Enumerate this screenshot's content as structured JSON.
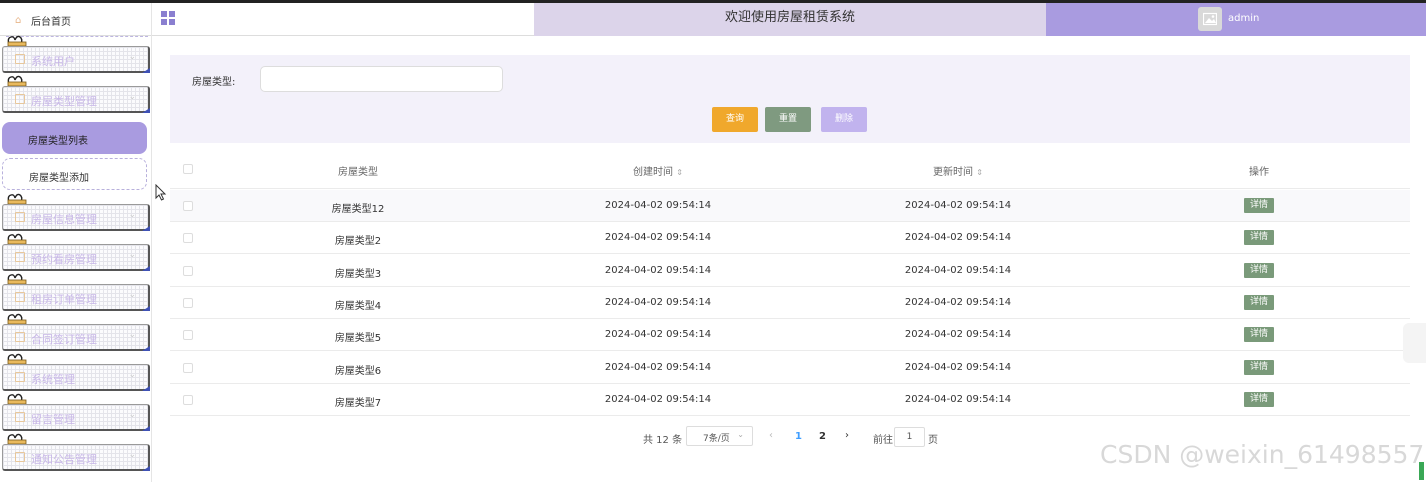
{
  "header": {
    "title": "欢迎使用房屋租赁系统",
    "username": "admin"
  },
  "sidebar": {
    "home_label": "后台首页",
    "items": [
      {
        "label": "系统用户"
      },
      {
        "label": "房屋类型管理"
      },
      {
        "label": "房屋信息管理"
      },
      {
        "label": "预约看房管理"
      },
      {
        "label": "租房订单管理"
      },
      {
        "label": "合同签订管理"
      },
      {
        "label": "系统管理"
      },
      {
        "label": "留言管理"
      },
      {
        "label": "通知公告管理"
      }
    ],
    "submenu": {
      "active": "房屋类型列表",
      "other": "房屋类型添加"
    }
  },
  "search": {
    "label": "房屋类型:",
    "value": "",
    "query_label": "查询",
    "reset_label": "重置",
    "delete_label": "删除"
  },
  "table": {
    "headers": {
      "type": "房屋类型",
      "created": "创建时间",
      "updated": "更新时间",
      "op": "操作"
    },
    "rows": [
      {
        "type": "房屋类型12",
        "created": "2024-04-02 09:54:14",
        "updated": "2024-04-02 09:54:14",
        "op": "详情"
      },
      {
        "type": "房屋类型2",
        "created": "2024-04-02 09:54:14",
        "updated": "2024-04-02 09:54:14",
        "op": "详情"
      },
      {
        "type": "房屋类型3",
        "created": "2024-04-02 09:54:14",
        "updated": "2024-04-02 09:54:14",
        "op": "详情"
      },
      {
        "type": "房屋类型4",
        "created": "2024-04-02 09:54:14",
        "updated": "2024-04-02 09:54:14",
        "op": "详情"
      },
      {
        "type": "房屋类型5",
        "created": "2024-04-02 09:54:14",
        "updated": "2024-04-02 09:54:14",
        "op": "详情"
      },
      {
        "type": "房屋类型6",
        "created": "2024-04-02 09:54:14",
        "updated": "2024-04-02 09:54:14",
        "op": "详情"
      },
      {
        "type": "房屋类型7",
        "created": "2024-04-02 09:54:14",
        "updated": "2024-04-02 09:54:14",
        "op": "详情"
      }
    ]
  },
  "pagination": {
    "total": "共 12 条",
    "page_size": "7条/页",
    "pages": [
      "1",
      "2"
    ],
    "current_page": "1",
    "goto_label": "前往",
    "goto_value": "1",
    "page_unit": "页"
  },
  "watermark": "CSDN @weixin_61498557",
  "colors": {
    "accent_purple": "#a99be0",
    "title_bar": "#dcd4ea",
    "query_button": "#f0a82c",
    "reset_button": "#7f9a80",
    "delete_button": "#c1b3ee",
    "detail_button": "#7a9a7a"
  }
}
